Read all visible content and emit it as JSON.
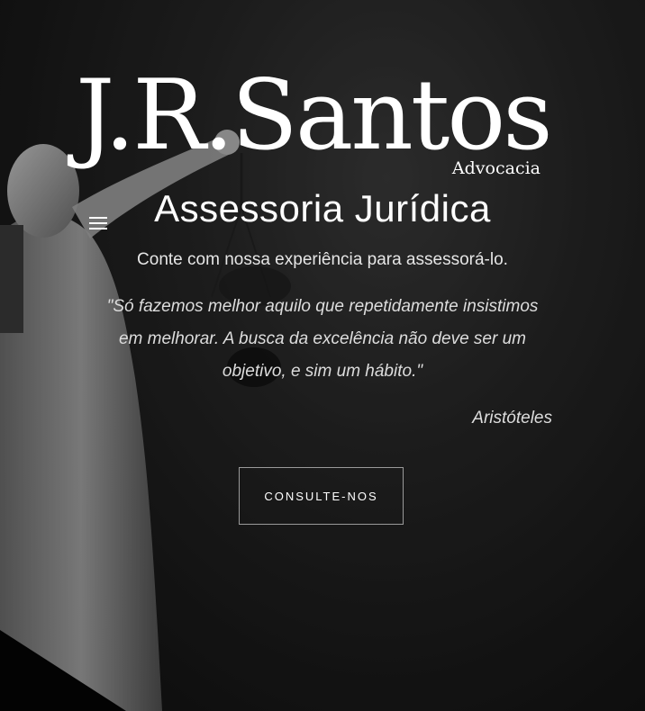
{
  "brand": {
    "name": "J.R.Santos",
    "tagline": "Advocacia"
  },
  "nav": {
    "menu_icon": "hamburger-menu-icon"
  },
  "hero": {
    "title": "Assessoria Jurídica",
    "lead": "Conte com nossa experiência para assessorá-lo.",
    "quote": "\"Só fazemos melhor aquilo que repetidamente insistimos em melhorar. A busca da excelência não deve ser um objetivo, e sim um hábito.\"",
    "quote_author": "Aristóteles",
    "cta_label": "CONSULTE-NOS"
  },
  "colors": {
    "text": "#ffffff",
    "background": "#1a1a1a",
    "button_border": "#9a9a9a"
  }
}
